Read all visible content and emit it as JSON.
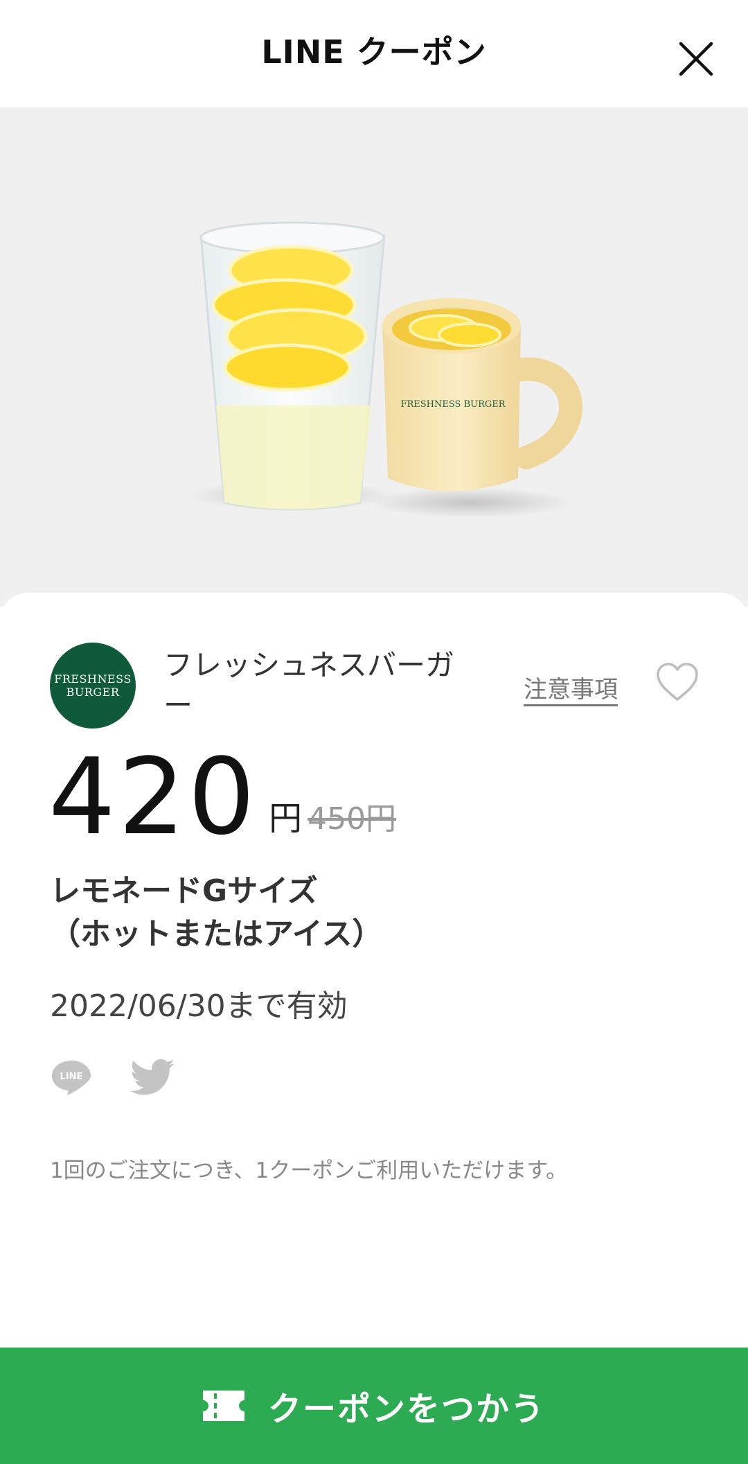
{
  "header": {
    "title": "LINE クーポン"
  },
  "brand": {
    "logo_line1": "FRESHNESS",
    "logo_line2": "BURGER",
    "name": "フレッシュネスバーガー",
    "notes_label": "注意事項"
  },
  "hero": {
    "mug_print": "FRESHNESS BURGER"
  },
  "price": {
    "value": "420",
    "unit": "円",
    "original": "450円"
  },
  "product": {
    "line1": "レモネードGサイズ",
    "line2": "（ホットまたはアイス）"
  },
  "valid_until": "2022/06/30まで有効",
  "share": {
    "line_icon_text": "LINE"
  },
  "notice": "1回のご注文につき、1クーポンご利用いただけます。",
  "cta": {
    "label": "クーポンをつかう"
  },
  "colors": {
    "accent": "#2dab52",
    "brand_green": "#0e5a3b",
    "hero_bg": "#f0f0f0"
  }
}
